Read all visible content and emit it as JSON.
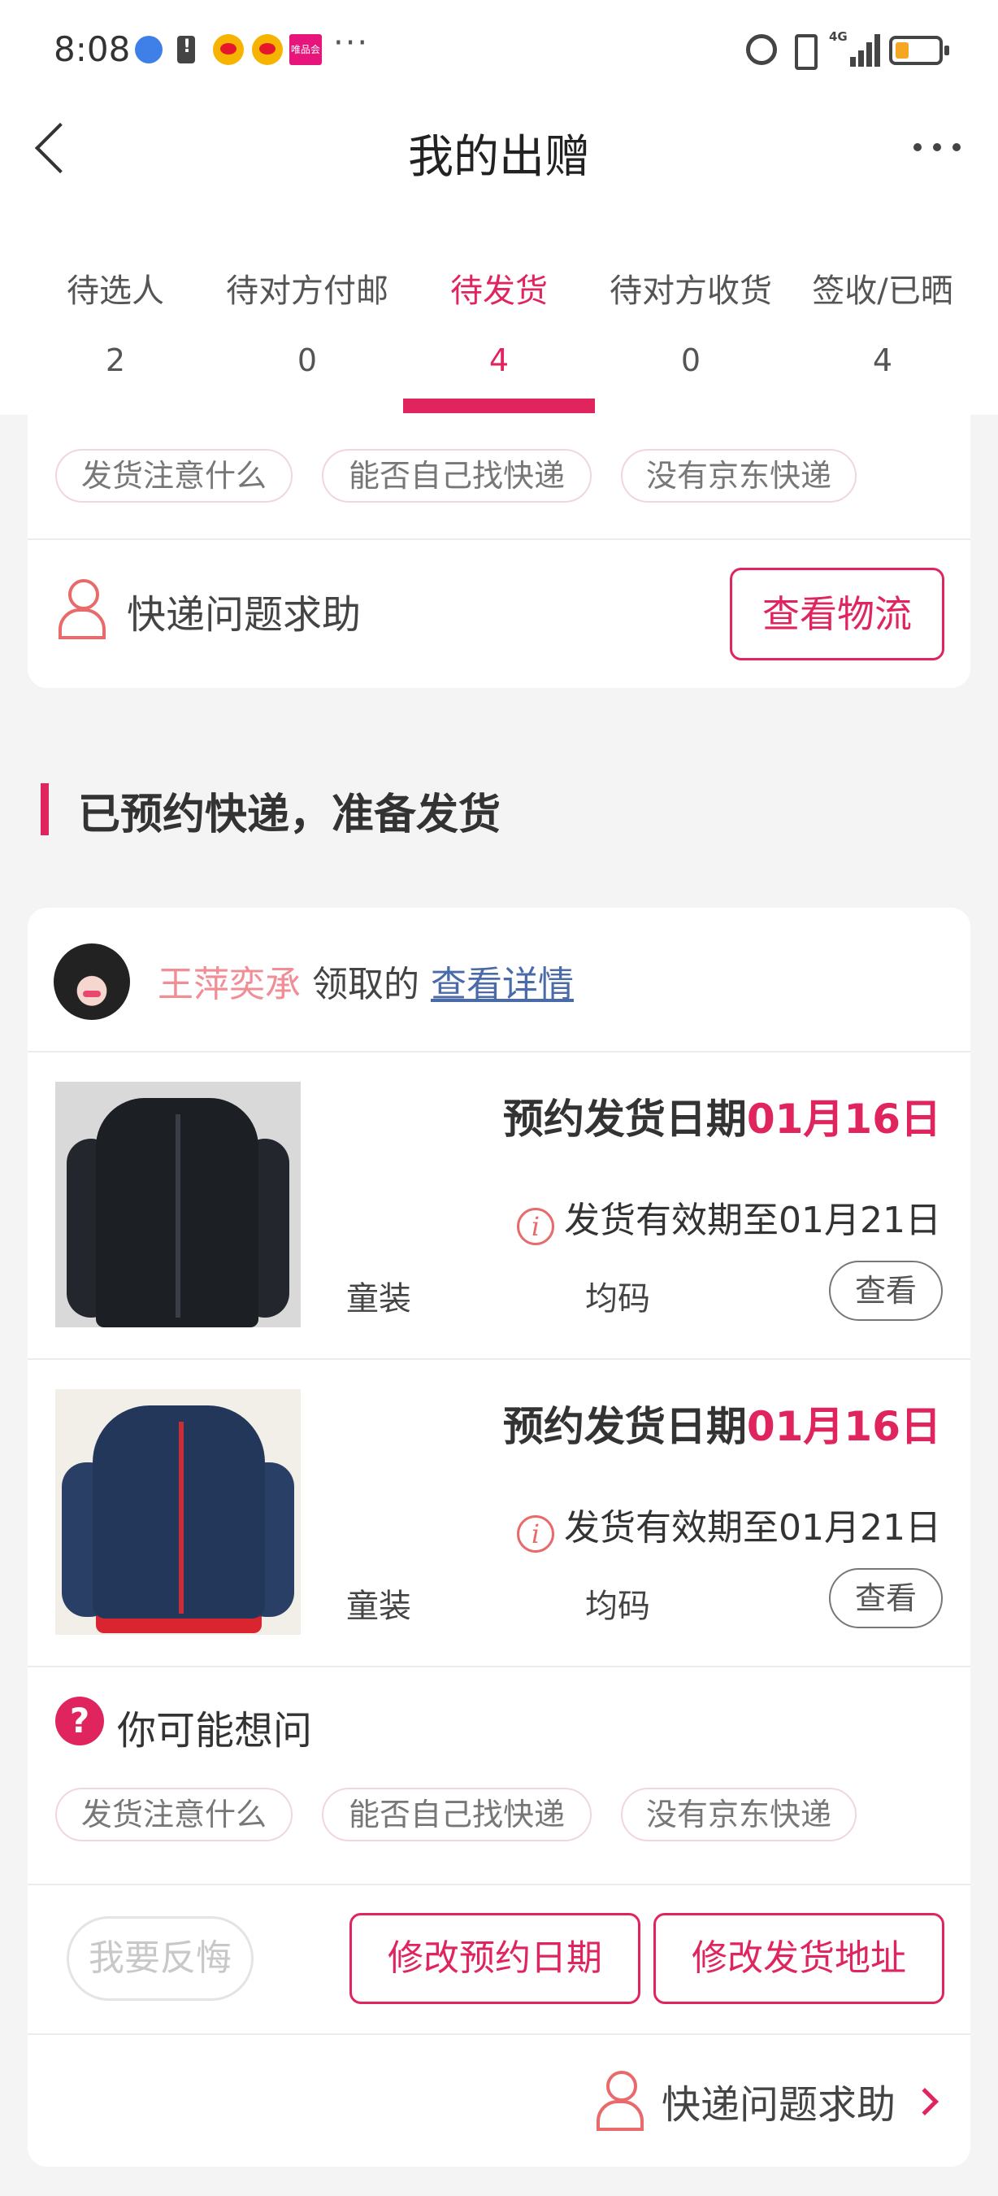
{
  "status_bar": {
    "time": "8:08",
    "more": "···",
    "network": "4G",
    "promo_text": "唯品会",
    "icons": [
      "globe-icon",
      "battery-warning-icon",
      "weibo-icon",
      "weibo-icon",
      "promo-app-icon",
      "alarm-icon",
      "vibrate-icon",
      "signal-icon",
      "battery-icon"
    ]
  },
  "header": {
    "title": "我的出赠",
    "back_icon": "chevron-left-icon",
    "more_icon": "more-dots-icon"
  },
  "tabs": [
    {
      "label": "待选人",
      "count": "2",
      "active": false
    },
    {
      "label": "待对方付邮",
      "count": "0",
      "active": false
    },
    {
      "label": "待发货",
      "count": "4",
      "active": true
    },
    {
      "label": "待对方收货",
      "count": "0",
      "active": false
    },
    {
      "label": "签收/已晒",
      "count": "4",
      "active": false
    }
  ],
  "top_card": {
    "faq_chips": [
      "发货注意什么",
      "能否自己找快递",
      "没有京东快递"
    ],
    "help_text": "快递问题求助",
    "logistics_button": "查看物流"
  },
  "section": {
    "title": "已预约快递，准备发货"
  },
  "order": {
    "receiver_name": "王萍奕承",
    "receiver_suffix": "领取的",
    "detail_link": "查看详情",
    "items": [
      {
        "date_label": "预约发货日期",
        "date_value": "01月16日",
        "valid_text": "发货有效期至01月21日",
        "category": "童装",
        "size": "均码",
        "view_label": "查看",
        "image": "black-kids-puffer-jacket"
      },
      {
        "date_label": "预约发货日期",
        "date_value": "01月16日",
        "valid_text": "发货有效期至01月21日",
        "category": "童装",
        "size": "均码",
        "view_label": "查看",
        "image": "navy-kids-puffer-jacket"
      }
    ],
    "faq_title": "你可能想问",
    "faq_icon": "question-icon",
    "faq_chips": [
      "发货注意什么",
      "能否自己找快递",
      "没有京东快递"
    ],
    "regret_button": "我要反悔",
    "modify_date_button": "修改预约日期",
    "modify_address_button": "修改发货地址",
    "help_text": "快递问题求助"
  },
  "colors": {
    "accent": "#e0245e",
    "receiver_name": "#f08d95",
    "link": "#4a6ba8",
    "background": "#f4f4f4"
  }
}
